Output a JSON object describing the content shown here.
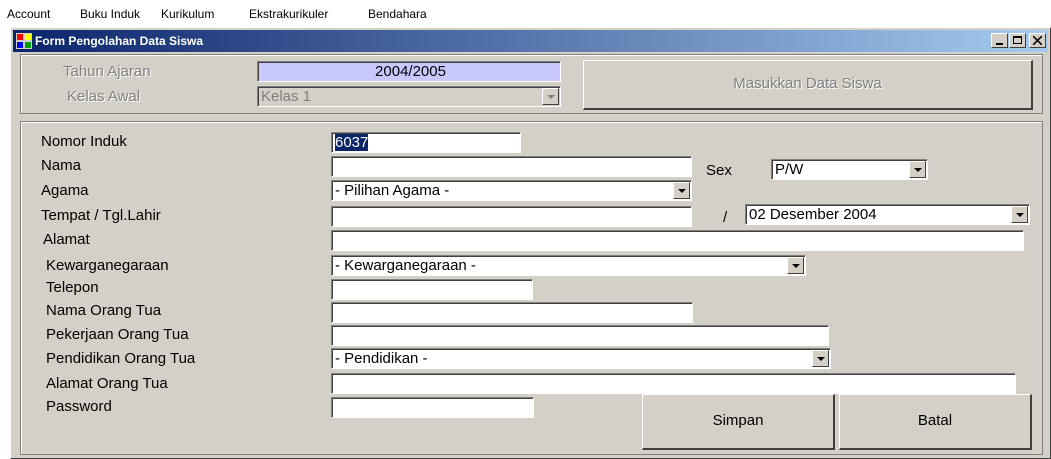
{
  "menubar": {
    "items": [
      "Account",
      "Buku Induk",
      "Kurikulum",
      "Ekstrakurikuler",
      "Bendahara"
    ]
  },
  "window": {
    "title": "Form Pengolahan Data Siswa"
  },
  "top_panel": {
    "tahun_ajaran_label": "Tahun Ajaran",
    "tahun_ajaran_value": "2004/2005",
    "kelas_awal_label": "Kelas Awal",
    "kelas_awal_value": "Kelas 1",
    "masukkan_button": "Masukkan Data Siswa"
  },
  "form": {
    "nomor_induk_label": "Nomor Induk",
    "nomor_induk_value": "6037",
    "nama_label": "Nama",
    "nama_value": "",
    "sex_label": "Sex",
    "sex_value": "P/W",
    "agama_label": "Agama",
    "agama_value": "- Pilihan Agama -",
    "tempat_tgl_label": "Tempat / Tgl.Lahir",
    "tempat_value": "",
    "date_separator": "/",
    "tgl_lahir_value": "02 Desember 2004",
    "alamat_label": "Alamat",
    "alamat_value": "",
    "kewarganegaraan_label": "Kewarganegaraan",
    "kewarganegaraan_value": "- Kewarganegaraan -",
    "telepon_label": "Telepon",
    "telepon_value": "",
    "nama_ortu_label": "Nama Orang Tua",
    "nama_ortu_value": "",
    "pekerjaan_ortu_label": "Pekerjaan Orang Tua",
    "pekerjaan_ortu_value": "",
    "pendidikan_ortu_label": "Pendidikan Orang Tua",
    "pendidikan_ortu_value": "- Pendidikan -",
    "alamat_ortu_label": "Alamat Orang Tua",
    "alamat_ortu_value": "",
    "password_label": "Password",
    "password_value": ""
  },
  "buttons": {
    "simpan": "Simpan",
    "batal": "Batal"
  },
  "colors": {
    "face": "#d4d0c8",
    "title_start": "#0a246a",
    "title_end": "#a6caf0",
    "tahun_bg": "#c8c8ff"
  }
}
